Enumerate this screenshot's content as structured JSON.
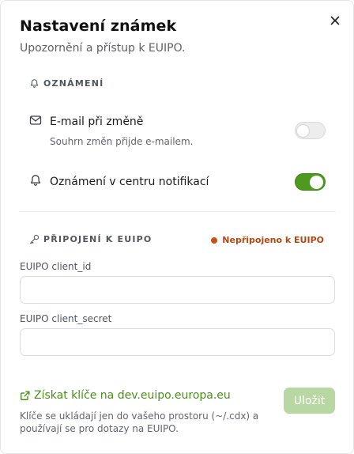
{
  "dialog": {
    "title": "Nastavení známek",
    "subtitle": "Upozornění a přístup k EUIPO."
  },
  "notifications_section": {
    "heading": "OZNÁMENÍ",
    "heading_icon": "bell-icon",
    "email": {
      "icon": "mail-icon",
      "label": "E-mail při změně",
      "description": "Souhrn změn přijde e-mailem.",
      "enabled": false
    },
    "center": {
      "icon": "bell-icon",
      "label": "Oznámení v centru notifikací",
      "enabled": true
    }
  },
  "connection_section": {
    "heading": "PŘIPOJENÍ K EUIPO",
    "heading_icon": "key-icon",
    "status": "Nepřipojeno k EUIPO",
    "status_color": "#c8511a"
  },
  "fields": {
    "client_id_label": "EUIPO client_id",
    "client_id_value": "",
    "client_secret_label": "EUIPO client_secret",
    "client_secret_value": ""
  },
  "footer": {
    "link_text": "Získat klíče na dev.euipo.europa.eu",
    "link_icon": "external-link-icon",
    "save_label": "Uložit",
    "save_enabled": false,
    "note": "Klíče se ukládají jen do vašeho prostoru (~/.cdx) a používají se pro dotazy na EUIPO."
  },
  "colors": {
    "accent": "#4d9a1e",
    "link": "#4a8f1a",
    "save_disabled": "#b9d7a3",
    "status_warning": "#b64612"
  }
}
